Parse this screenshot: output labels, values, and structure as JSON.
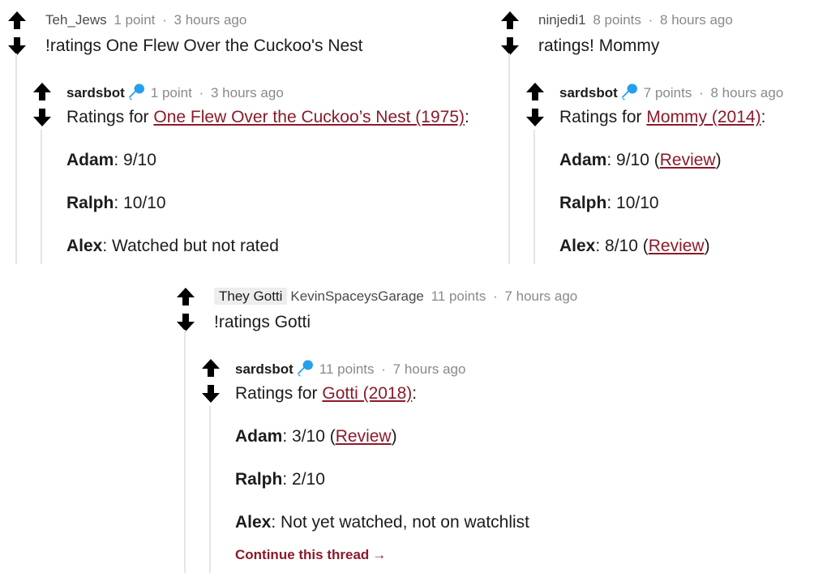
{
  "left": {
    "parent": {
      "author": "Teh_Jews",
      "points": "1 point",
      "time": "3 hours ago",
      "text": "!ratings One Flew Over the Cuckoo's Nest"
    },
    "bot": {
      "author": "sardsbot",
      "points": "1 point",
      "time": "3 hours ago",
      "ratings_prefix": "Ratings for ",
      "title_link": "One Flew Over the Cuckoo’s Nest (1975)",
      "suffix": ":",
      "adam_name": "Adam",
      "adam_value": ": 9/10",
      "ralph_name": "Ralph",
      "ralph_value": ": 10/10",
      "alex_name": "Alex",
      "alex_value": ": Watched but not rated"
    }
  },
  "right": {
    "parent": {
      "author": "ninjedi1",
      "points": "8 points",
      "time": "8 hours ago",
      "text": "ratings! Mommy"
    },
    "bot": {
      "author": "sardsbot",
      "points": "7 points",
      "time": "8 hours ago",
      "ratings_prefix": "Ratings for ",
      "title_link": "Mommy (2014)",
      "suffix": ":",
      "adam_name": "Adam",
      "adam_value": ": 9/10 (",
      "adam_review": "Review",
      "adam_close": ")",
      "ralph_name": "Ralph",
      "ralph_value": ": 10/10",
      "alex_name": "Alex",
      "alex_value": ": 8/10 (",
      "alex_review": "Review",
      "alex_close": ")"
    }
  },
  "middle": {
    "parent": {
      "flair": "They Gotti",
      "author": "KevinSpaceysGarage",
      "points": "11 points",
      "time": "7 hours ago",
      "text": "!ratings Gotti"
    },
    "bot": {
      "author": "sardsbot",
      "points": "11 points",
      "time": "7 hours ago",
      "ratings_prefix": "Ratings for ",
      "title_link": "Gotti (2018)",
      "suffix": ":",
      "adam_name": "Adam",
      "adam_value": ": 3/10 (",
      "adam_review": "Review",
      "adam_close": ")",
      "ralph_name": "Ralph",
      "ralph_value": ": 2/10",
      "alex_name": "Alex",
      "alex_value": ": Not yet watched, not on watchlist"
    },
    "continue_label": "Continue this thread"
  },
  "separator": "·",
  "colors": {
    "link": "#8b1a2a",
    "meta": "#878a8c",
    "text": "#1c1c1c",
    "thread_line": "#e4e5e6",
    "mic": "#24a0ed"
  }
}
